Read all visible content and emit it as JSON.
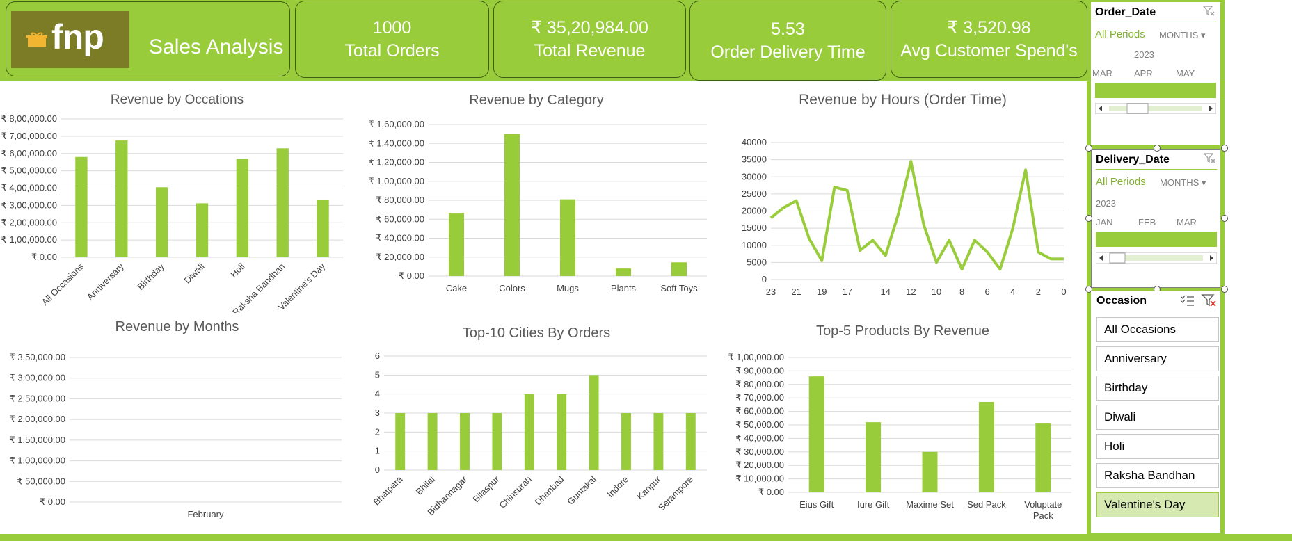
{
  "header": {
    "logo_text": "fnp",
    "title": "Sales Analysis"
  },
  "kpis": [
    {
      "value": "1000",
      "label": "Total Orders"
    },
    {
      "value": "₹ 35,20,984.00",
      "label": "Total Revenue"
    },
    {
      "value": "5.53",
      "label": "Order  Delivery Time"
    },
    {
      "value": "₹ 3,520.98",
      "label": "Avg Customer Spend's"
    }
  ],
  "colors": {
    "accent": "#99cc3b",
    "bar": "#99cc3b",
    "grid": "#d9d9d9",
    "title": "#595959"
  },
  "chart_data": [
    {
      "id": "occasions",
      "type": "bar",
      "title": "Revenue by Occations",
      "categories": [
        "All Occasions",
        "Anniversary",
        "Birthday",
        "Diwali",
        "Holi",
        "Raksha Bandhan",
        "Valentine's Day"
      ],
      "values": [
        580000,
        675000,
        405000,
        312000,
        570000,
        630000,
        330000
      ],
      "yticks": [
        "₹ 0.00",
        "₹ 1,00,000.00",
        "₹ 2,00,000.00",
        "₹ 3,00,000.00",
        "₹ 4,00,000.00",
        "₹ 5,00,000.00",
        "₹ 6,00,000.00",
        "₹ 7,00,000.00",
        "₹ 8,00,000.00"
      ],
      "ylim": [
        0,
        800000
      ]
    },
    {
      "id": "category",
      "type": "bar",
      "title": "Revenue by Category",
      "categories": [
        "Cake",
        "Colors",
        "Mugs",
        "Plants",
        "Soft Toys"
      ],
      "values": [
        66000,
        150000,
        81000,
        8000,
        14500
      ],
      "yticks": [
        "₹ 0.00",
        "₹ 20,000.00",
        "₹ 40,000.00",
        "₹ 60,000.00",
        "₹ 80,000.00",
        "₹ 1,00,000.00",
        "₹ 1,20,000.00",
        "₹ 1,40,000.00",
        "₹ 1,60,000.00"
      ],
      "ylim": [
        0,
        160000
      ]
    },
    {
      "id": "hours",
      "type": "line",
      "title": "Revenue  by Hours (Order Time)",
      "x": [
        23,
        22,
        21,
        20,
        19,
        18,
        17,
        16,
        15,
        14,
        13,
        12,
        11,
        10,
        9,
        8,
        7,
        6,
        5,
        4,
        3,
        2,
        1,
        0
      ],
      "values": [
        18000,
        21000,
        23000,
        12000,
        5500,
        27000,
        26000,
        8500,
        11500,
        7000,
        19000,
        34500,
        16000,
        5000,
        11500,
        3000,
        11500,
        8000,
        3000,
        15000,
        32000,
        8000,
        6000,
        6000
      ],
      "xtick_labels": [
        "23",
        "21",
        "19",
        "17",
        "14",
        "12",
        "10",
        "8",
        "6",
        "4",
        "2",
        "0"
      ],
      "yticks": [
        "0",
        "5000",
        "10000",
        "15000",
        "20000",
        "25000",
        "30000",
        "35000",
        "40000"
      ],
      "ylim": [
        0,
        40000
      ]
    },
    {
      "id": "months",
      "type": "bar",
      "title": "Revenue by Months",
      "categories": [
        "February"
      ],
      "values": [
        0
      ],
      "yticks": [
        "₹ 0.00",
        "₹ 50,000.00",
        "₹ 1,00,000.00",
        "₹ 1,50,000.00",
        "₹ 2,00,000.00",
        "₹ 2,50,000.00",
        "₹ 3,00,000.00",
        "₹ 3,50,000.00"
      ],
      "ylim": [
        0,
        350000
      ]
    },
    {
      "id": "cities",
      "type": "bar",
      "title": "Top-10 Cities By Orders",
      "categories": [
        "Bhatpara",
        "Bhilai",
        "Bidhannagar",
        "Bilaspur",
        "Chinsurah",
        "Dhanbad",
        "Guntakal",
        "Indore",
        "Kanpur",
        "Serampore"
      ],
      "values": [
        3,
        3,
        3,
        3,
        4,
        4,
        5,
        3,
        3,
        3
      ],
      "yticks": [
        "0",
        "1",
        "2",
        "3",
        "4",
        "5",
        "6"
      ],
      "ylim": [
        0,
        6
      ]
    },
    {
      "id": "products",
      "type": "bar",
      "title": "Top-5 Products By Revenue",
      "categories": [
        "Eius Gift",
        "Iure Gift",
        "Maxime Set",
        "Sed Pack",
        "Voluptate Pack"
      ],
      "values": [
        86000,
        52000,
        30000,
        67000,
        51000
      ],
      "yticks": [
        "₹ 0.00",
        "₹ 10,000.00",
        "₹ 20,000.00",
        "₹ 30,000.00",
        "₹ 40,000.00",
        "₹ 50,000.00",
        "₹ 60,000.00",
        "₹ 70,000.00",
        "₹ 80,000.00",
        "₹ 90,000.00",
        "₹ 1,00,000.00"
      ],
      "ylim": [
        0,
        100000
      ]
    }
  ],
  "slicers": {
    "order_date": {
      "title": "Order_Date",
      "all": "All Periods",
      "unit": "MONTHS",
      "year": "2023",
      "months": [
        "MAR",
        "APR",
        "MAY"
      ]
    },
    "delivery_date": {
      "title": "Delivery_Date",
      "all": "All Periods",
      "unit": "MONTHS",
      "year": "2023",
      "months": [
        "JAN",
        "FEB",
        "MAR"
      ]
    },
    "occasion": {
      "title": "Occasion",
      "items": [
        "All Occasions",
        "Anniversary",
        "Birthday",
        "Diwali",
        "Holi",
        "Raksha Bandhan",
        "Valentine's Day"
      ],
      "selected": "Valentine's Day"
    }
  }
}
